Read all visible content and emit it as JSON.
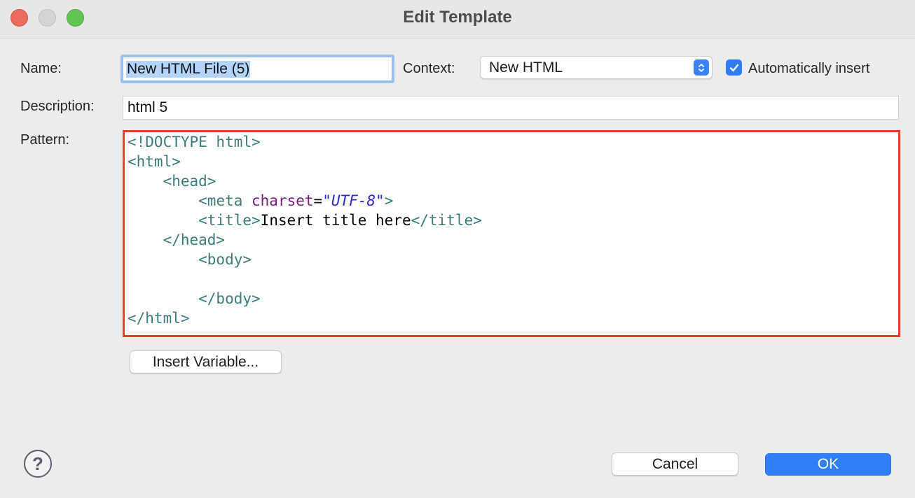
{
  "window": {
    "title": "Edit Template"
  },
  "form": {
    "name_label": "Name:",
    "name_value": "New HTML File (5)",
    "context_label": "Context:",
    "context_value": "New HTML",
    "auto_insert_label": "Automatically insert",
    "auto_insert_checked": true,
    "description_label": "Description:",
    "description_value": "html 5",
    "pattern_label": "Pattern:"
  },
  "pattern_lines": [
    "<!DOCTYPE html>",
    "<html>",
    "    <head>",
    "        <meta charset=\"UTF-8\">",
    "        <title>Insert title here</title>",
    "    </head>",
    "        <body>",
    "",
    "        </body>",
    "</html>"
  ],
  "buttons": {
    "insert_variable": "Insert Variable...",
    "cancel": "Cancel",
    "ok": "OK",
    "help": "?"
  },
  "colors": {
    "accent": "#2f80f6",
    "highlight_border": "#e4412b",
    "tag": "#3d7d7d",
    "attribute": "#7a1f7a",
    "string": "#2b2bd8"
  }
}
